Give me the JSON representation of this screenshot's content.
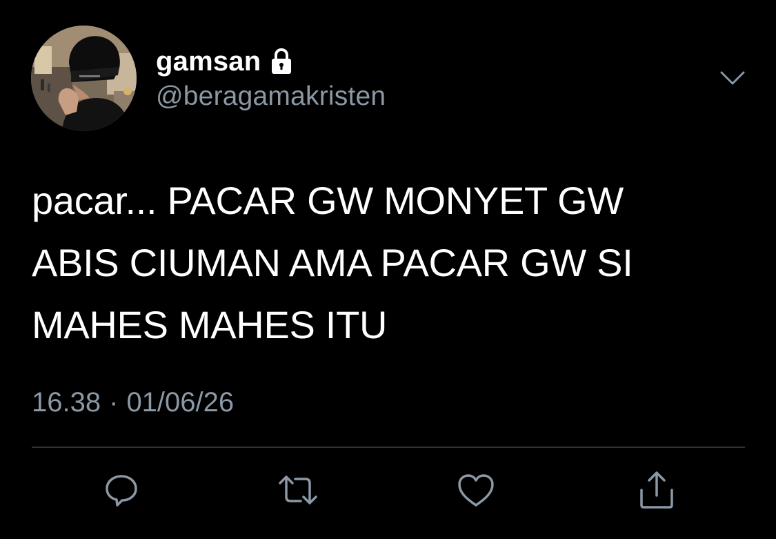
{
  "user": {
    "display_name": "gamsan",
    "handle": "@beragamakristen",
    "avatar_icon": "avatar-photo",
    "locked_icon": "lock-icon"
  },
  "tweet": {
    "text_lines": [
      "pacar... PACAR GW MONYET GW",
      "ABIS CIUMAN AMA PACAR GW SI",
      "MAHES MAHES ITU"
    ],
    "time": "16.38",
    "separator": "·",
    "date": "01/06/26"
  },
  "actions": {
    "reply_icon": "reply-icon",
    "retweet_icon": "retweet-icon",
    "like_icon": "heart-icon",
    "share_icon": "share-icon",
    "menu_icon": "chevron-down-icon"
  },
  "colors": {
    "background": "#000000",
    "primary_text": "#ffffff",
    "secondary_text": "#8b98a5",
    "divider": "#2f3336"
  }
}
